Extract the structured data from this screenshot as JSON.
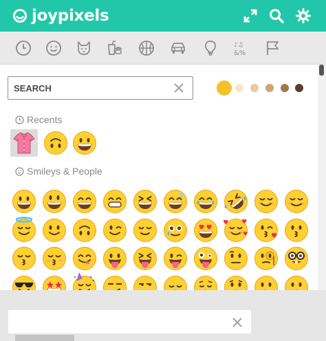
{
  "app": {
    "brand_name": "joypixels",
    "brand_color": "#22c7a9",
    "header_icons": [
      "expand-icon",
      "search-icon",
      "gear-icon"
    ]
  },
  "categories": [
    {
      "key": "recent",
      "icon": "clock-icon"
    },
    {
      "key": "people",
      "icon": "smiley-icon"
    },
    {
      "key": "nature",
      "icon": "cat-icon"
    },
    {
      "key": "food",
      "icon": "food-icon"
    },
    {
      "key": "activity",
      "icon": "ball-icon"
    },
    {
      "key": "travel",
      "icon": "car-icon"
    },
    {
      "key": "objects",
      "icon": "bulb-icon"
    },
    {
      "key": "symbols",
      "icon": "symbols-icon"
    },
    {
      "key": "flags",
      "icon": "flag-icon"
    }
  ],
  "search": {
    "placeholder": "SEARCH",
    "value": ""
  },
  "skin_tones": {
    "selected": "#f5c02c",
    "options": [
      "#f5c02c",
      "#fbe4cd",
      "#e9c9a0",
      "#cfa27a",
      "#a6774f",
      "#5c3e2a"
    ]
  },
  "sections": {
    "recents": {
      "title": "Recents",
      "emojis": [
        "shirt",
        "upside-down-face",
        "grinning-face"
      ]
    },
    "smileys": {
      "title": "Smileys & People",
      "rows": [
        [
          "grinning-face",
          "smiley-face",
          "smile-face",
          "grin-face",
          "laughing-face",
          "sweat-smile-face",
          "joy-face",
          "rofl-face",
          "blush-face",
          "relaxed-face"
        ],
        [
          "innocent-face",
          "slight-smile-face",
          "upside-down-face",
          "wink-face",
          "relieved-face",
          "crying-smile-face",
          "heart-eyes-face",
          "hearts-face",
          "kiss-heart-face",
          "kissing-face"
        ],
        [
          "kissing-smile-face",
          "kissing-closed-eyes-face",
          "yum-face",
          "tongue-face",
          "squint-tongue-face",
          "wink-tongue-face",
          "zany-face",
          "raised-brow-face",
          "monocle-face",
          "nerd-face"
        ],
        [
          "sunglasses-face",
          "star-struck-face",
          "partying-face",
          "smirk-face",
          "unamused-face",
          "disappointed-face",
          "pensive-face",
          "worried-face",
          "confused-face",
          "slight-frown-face"
        ]
      ]
    }
  },
  "footer": {
    "field_value": ""
  }
}
